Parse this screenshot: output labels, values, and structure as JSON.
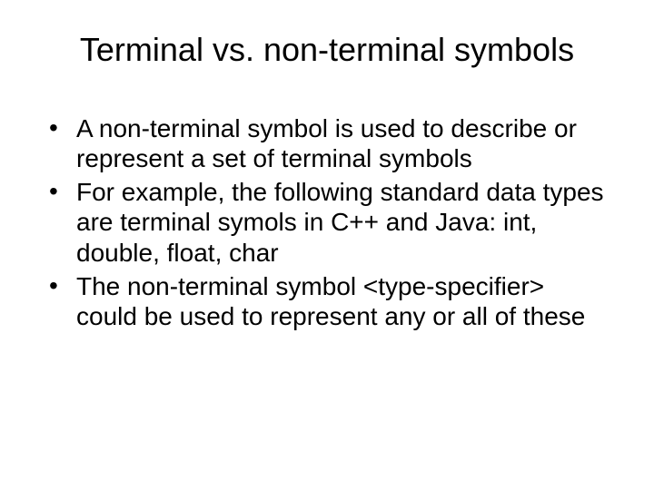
{
  "slide": {
    "title": "Terminal vs. non-terminal symbols",
    "bullets": [
      "A non-terminal symbol is used to describe or represent a set of terminal symbols",
      "For example, the following standard data types are terminal symols in C++ and Java: int, double, float, char",
      "The non-terminal symbol <type-specifier> could be used to represent any or all of these"
    ]
  }
}
